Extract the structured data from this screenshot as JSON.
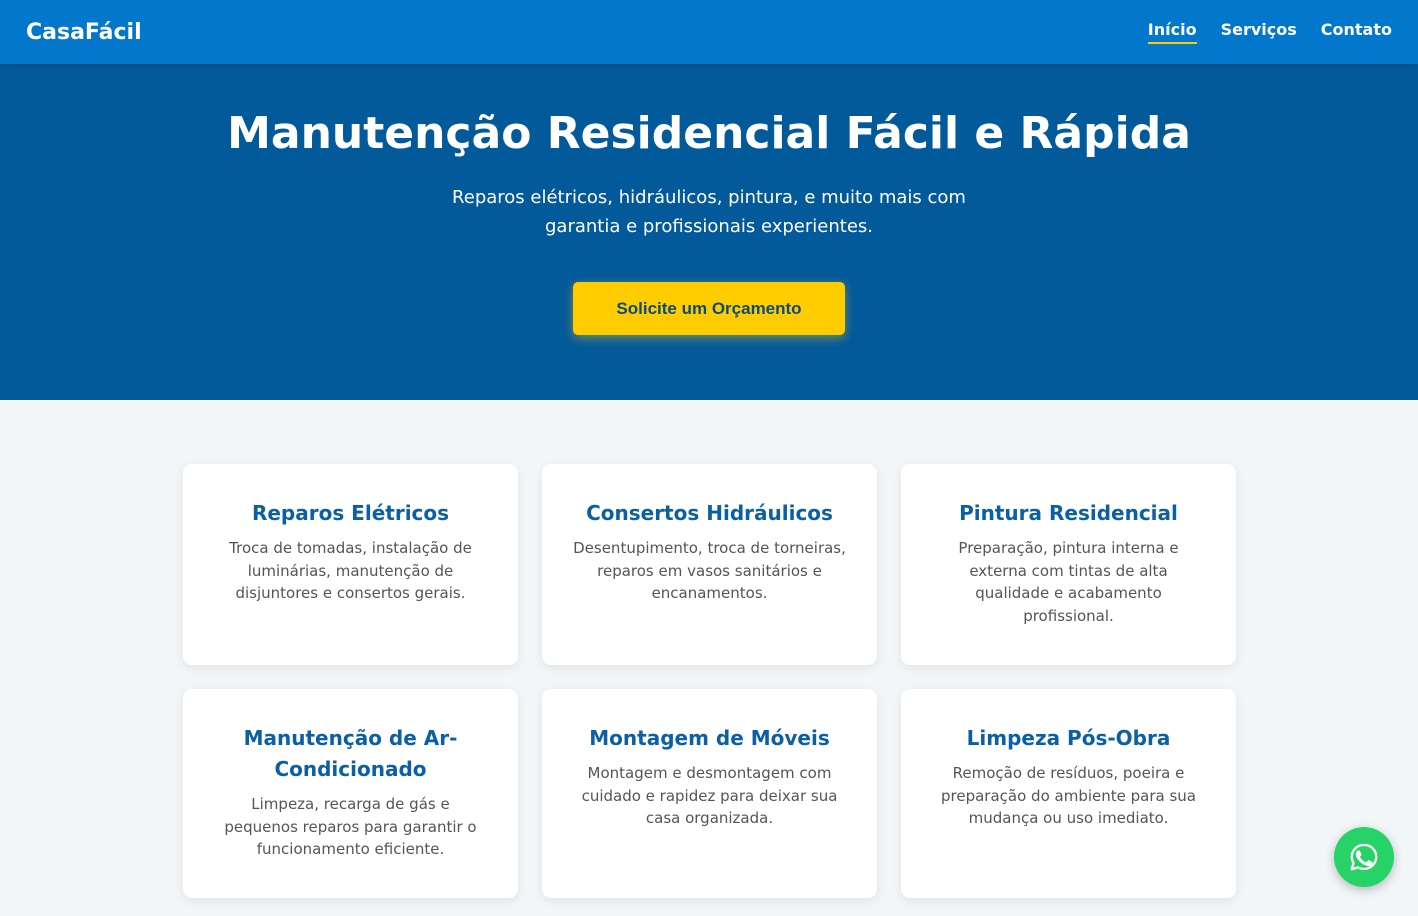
{
  "header": {
    "logo": "CasaFácil",
    "nav": [
      {
        "label": "Início",
        "active": true
      },
      {
        "label": "Serviços",
        "active": false
      },
      {
        "label": "Contato",
        "active": false
      }
    ]
  },
  "hero": {
    "title": "Manutenção Residencial Fácil e Rápida",
    "subtitle": "Reparos elétricos, hidráulicos, pintura, e muito mais com garantia e profissionais experientes.",
    "cta_label": "Solicite um Orçamento"
  },
  "services": [
    {
      "title": "Reparos Elétricos",
      "description": "Troca de tomadas, instalação de luminárias, manutenção de disjuntores e consertos gerais."
    },
    {
      "title": "Consertos Hidráulicos",
      "description": "Desentupimento, troca de torneiras, reparos em vasos sanitários e encanamentos."
    },
    {
      "title": "Pintura Residencial",
      "description": "Preparação, pintura interna e externa com tintas de alta qualidade e acabamento profissional."
    },
    {
      "title": "Manutenção de Ar-Condicionado",
      "description": "Limpeza, recarga de gás e pequenos reparos para garantir o funcionamento eficiente."
    },
    {
      "title": "Montagem de Móveis",
      "description": "Montagem e desmontagem com cuidado e rapidez para deixar sua casa organizada."
    },
    {
      "title": "Limpeza Pós-Obra",
      "description": "Remoção de resíduos, poeira e preparação do ambiente para sua mudança ou uso imediato."
    }
  ],
  "floating": {
    "icon": "whatsapp-icon"
  },
  "colors": {
    "header": "#0277cc",
    "hero": "#035a9a",
    "accent": "#ffcc00",
    "card_title": "#0a5fa5",
    "whatsapp": "#25d366"
  }
}
